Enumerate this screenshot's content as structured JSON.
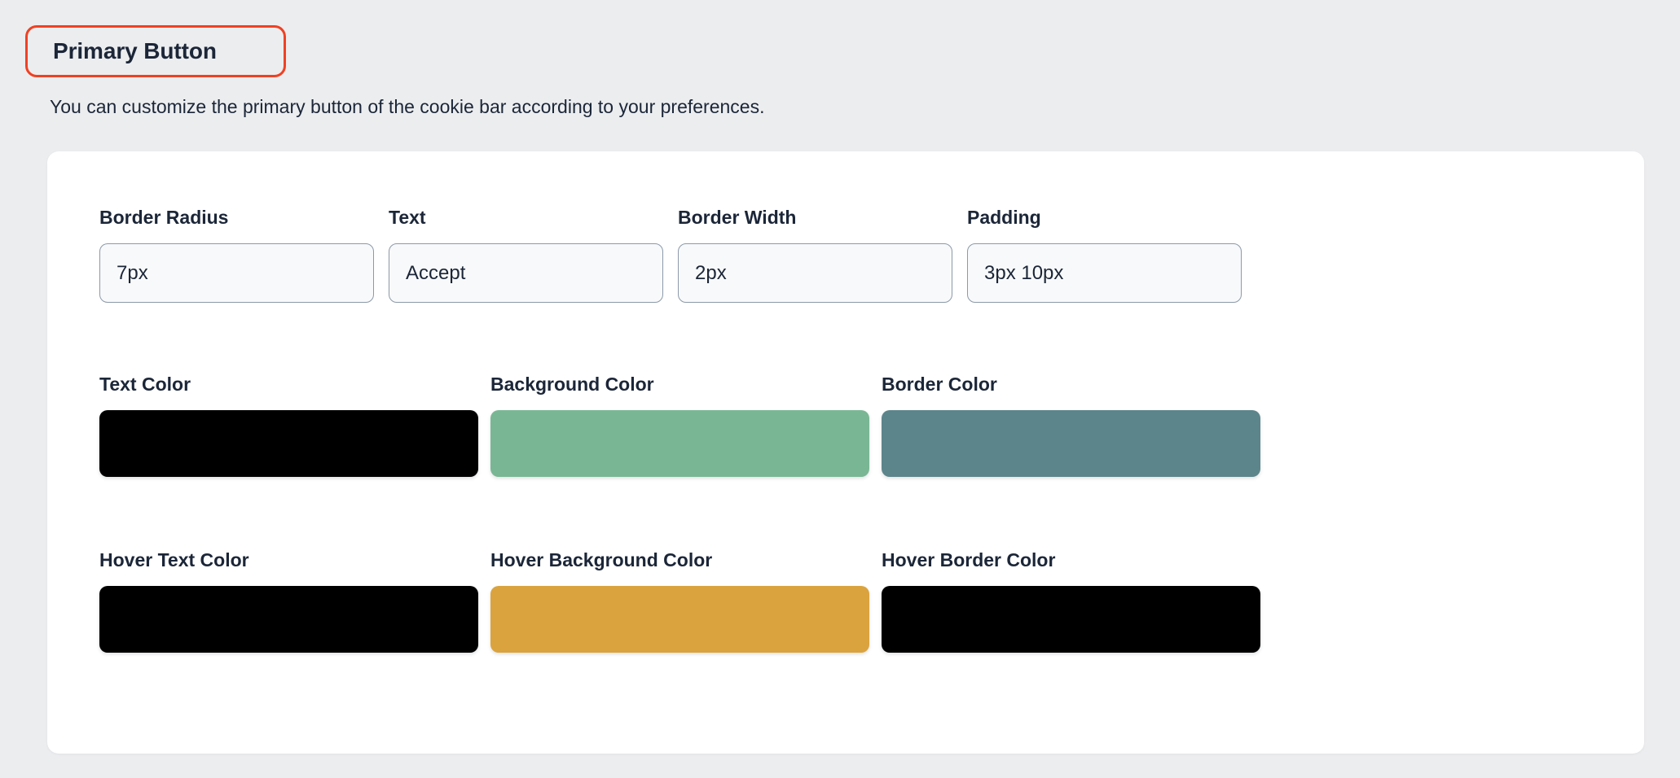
{
  "header": {
    "title": "Primary Button",
    "subtitle": "You can customize the primary button of the cookie bar according to your preferences.",
    "annotation_color": "#ef4123"
  },
  "theme": {
    "page_background": "#ecedef",
    "card_background": "#ffffff",
    "text_color": "#1b2638",
    "input_background": "#f8f9fa",
    "input_border": "#8c99a9"
  },
  "fields": [
    {
      "label": "Border Radius",
      "value": "7px",
      "placeholder": "Border Radius"
    },
    {
      "label": "Text",
      "value": "Accept",
      "placeholder": "Text"
    },
    {
      "label": "Border Width",
      "value": "2px",
      "placeholder": "Border Width"
    },
    {
      "label": "Padding",
      "value": "3px 10px",
      "placeholder": "Padding"
    }
  ],
  "color_rows": [
    {
      "swatches": [
        {
          "label": "Text Color",
          "color": "#000000"
        },
        {
          "label": "Background Color",
          "color": "#79b794"
        },
        {
          "label": "Border Color",
          "color": "#5c858b"
        }
      ]
    },
    {
      "swatches": [
        {
          "label": "Hover Text Color",
          "color": "#000000"
        },
        {
          "label": "Hover Background Color",
          "color": "#dba33e"
        },
        {
          "label": "Hover Border Color",
          "color": "#000000"
        }
      ]
    }
  ]
}
